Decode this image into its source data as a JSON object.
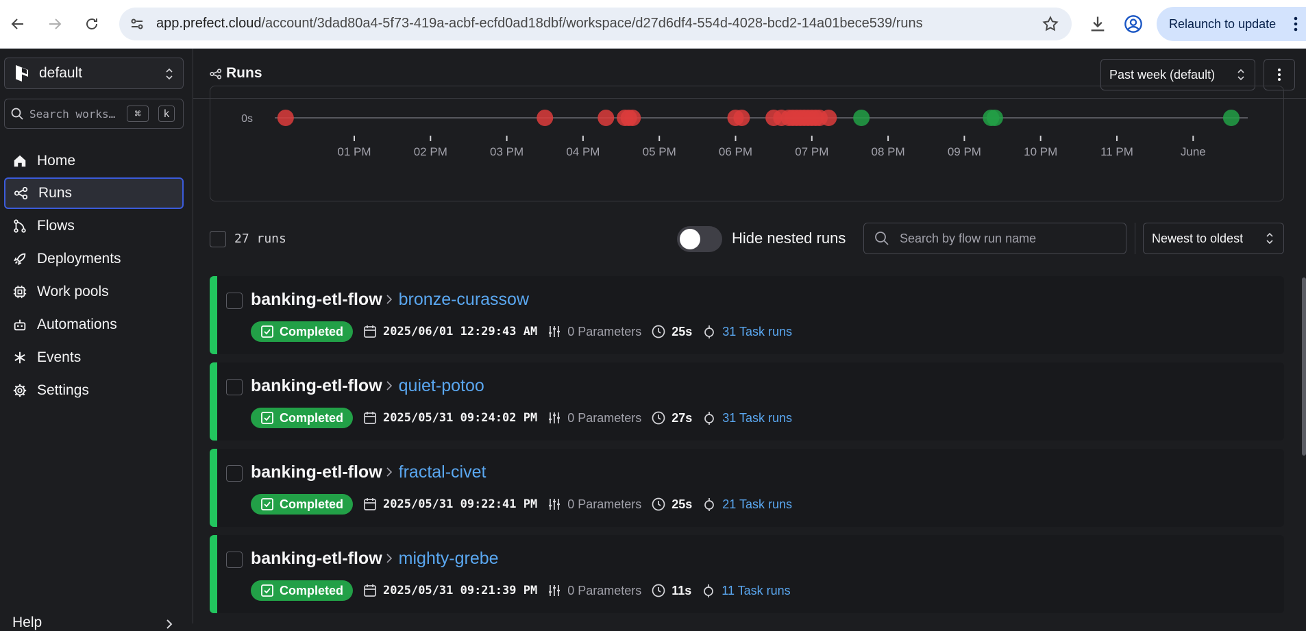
{
  "browser": {
    "url_host": "app.prefect.cloud",
    "url_path": "/account/3dad80a4-5f73-419a-acbf-ecfd0ad18dbf/workspace/d27d6df4-554d-4028-bcd2-14a01bece539/runs",
    "relaunch_label": "Relaunch to update"
  },
  "sidebar": {
    "workspace": "default",
    "search_placeholder": "Search works…",
    "shortcut_cmd": "⌘",
    "shortcut_key": "k",
    "items": [
      {
        "label": "Home",
        "icon": "home-icon"
      },
      {
        "label": "Runs",
        "icon": "runs-icon",
        "active": true
      },
      {
        "label": "Flows",
        "icon": "flows-icon"
      },
      {
        "label": "Deployments",
        "icon": "rocket-icon"
      },
      {
        "label": "Work pools",
        "icon": "cpu-icon"
      },
      {
        "label": "Automations",
        "icon": "robot-icon"
      },
      {
        "label": "Events",
        "icon": "asterisk-icon"
      },
      {
        "label": "Settings",
        "icon": "gear-icon"
      }
    ],
    "help_label": "Help"
  },
  "header": {
    "title": "Runs",
    "range": "Past week (default)"
  },
  "chart_data": {
    "type": "scatter",
    "ylabel_tick": "0s",
    "x_ticks": [
      "01 PM",
      "02 PM",
      "03 PM",
      "04 PM",
      "05 PM",
      "06 PM",
      "07 PM",
      "08 PM",
      "09 PM",
      "10 PM",
      "11 PM",
      "June"
    ],
    "series": [
      {
        "status": "failed",
        "color": "#dc3c3c",
        "x_hours": [
          12.1,
          15.5,
          16.3,
          16.55,
          16.6,
          16.65,
          18.0,
          18.08,
          18.5,
          18.6,
          18.7,
          18.75,
          18.8,
          18.85,
          18.9,
          18.95,
          19.0,
          19.05,
          19.1,
          19.22
        ]
      },
      {
        "status": "completed",
        "color": "#22a047",
        "x_hours": [
          19.65,
          21.35,
          21.4,
          24.5
        ]
      }
    ],
    "y_values_s": 0
  },
  "toolbar": {
    "count": "27 runs",
    "hide_nested": "Hide nested runs",
    "search_placeholder": "Search by flow run name",
    "sort": "Newest to oldest"
  },
  "runs": [
    {
      "flow": "banking-etl-flow",
      "name": "bronze-curassow",
      "state": "Completed",
      "start": "2025/06/01 12:29:43 AM",
      "params": "0 Parameters",
      "duration": "25s",
      "tasks": "31 Task runs"
    },
    {
      "flow": "banking-etl-flow",
      "name": "quiet-potoo",
      "state": "Completed",
      "start": "2025/05/31 09:24:02 PM",
      "params": "0 Parameters",
      "duration": "27s",
      "tasks": "31 Task runs"
    },
    {
      "flow": "banking-etl-flow",
      "name": "fractal-civet",
      "state": "Completed",
      "start": "2025/05/31 09:22:41 PM",
      "params": "0 Parameters",
      "duration": "25s",
      "tasks": "21 Task runs"
    },
    {
      "flow": "banking-etl-flow",
      "name": "mighty-grebe",
      "state": "Completed",
      "start": "2025/05/31 09:21:39 PM",
      "params": "0 Parameters",
      "duration": "11s",
      "tasks": "11 Task runs"
    }
  ]
}
